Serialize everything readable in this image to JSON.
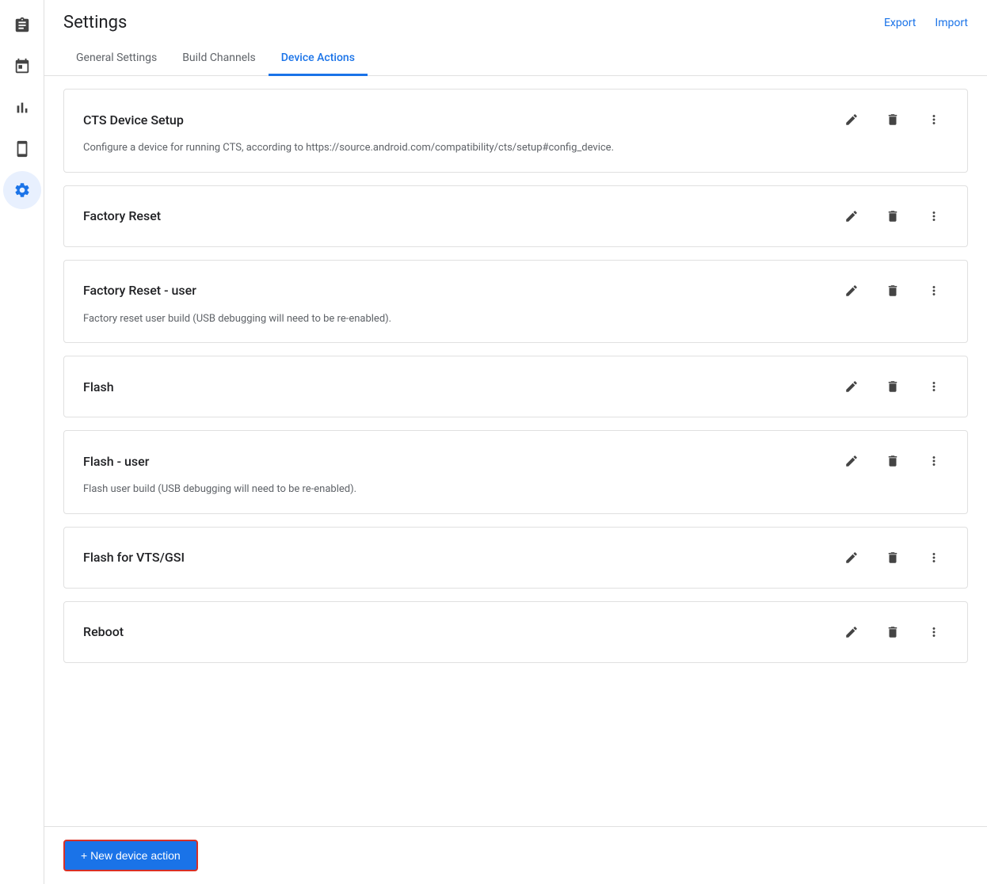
{
  "page": {
    "title": "Settings",
    "export_label": "Export",
    "import_label": "Import"
  },
  "sidebar": {
    "items": [
      {
        "id": "clipboard",
        "icon": "clipboard",
        "active": false
      },
      {
        "id": "calendar",
        "icon": "calendar",
        "active": false
      },
      {
        "id": "chart",
        "icon": "chart",
        "active": false
      },
      {
        "id": "device",
        "icon": "device",
        "active": false
      },
      {
        "id": "settings",
        "icon": "settings",
        "active": true
      }
    ]
  },
  "tabs": [
    {
      "id": "general",
      "label": "General Settings",
      "active": false
    },
    {
      "id": "build-channels",
      "label": "Build Channels",
      "active": false
    },
    {
      "id": "device-actions",
      "label": "Device Actions",
      "active": true
    }
  ],
  "actions": [
    {
      "id": "cts-device-setup",
      "name": "CTS Device Setup",
      "description": "Configure a device for running CTS, according to https://source.android.com/compatibility/cts/setup#config_device."
    },
    {
      "id": "factory-reset",
      "name": "Factory Reset",
      "description": ""
    },
    {
      "id": "factory-reset-user",
      "name": "Factory Reset - user",
      "description": "Factory reset user build (USB debugging will need to be re-enabled)."
    },
    {
      "id": "flash",
      "name": "Flash",
      "description": ""
    },
    {
      "id": "flash-user",
      "name": "Flash - user",
      "description": "Flash user build (USB debugging will need to be re-enabled)."
    },
    {
      "id": "flash-vts-gsi",
      "name": "Flash for VTS/GSI",
      "description": ""
    },
    {
      "id": "reboot",
      "name": "Reboot",
      "description": ""
    }
  ],
  "footer": {
    "new_action_label": "+ New device action"
  }
}
